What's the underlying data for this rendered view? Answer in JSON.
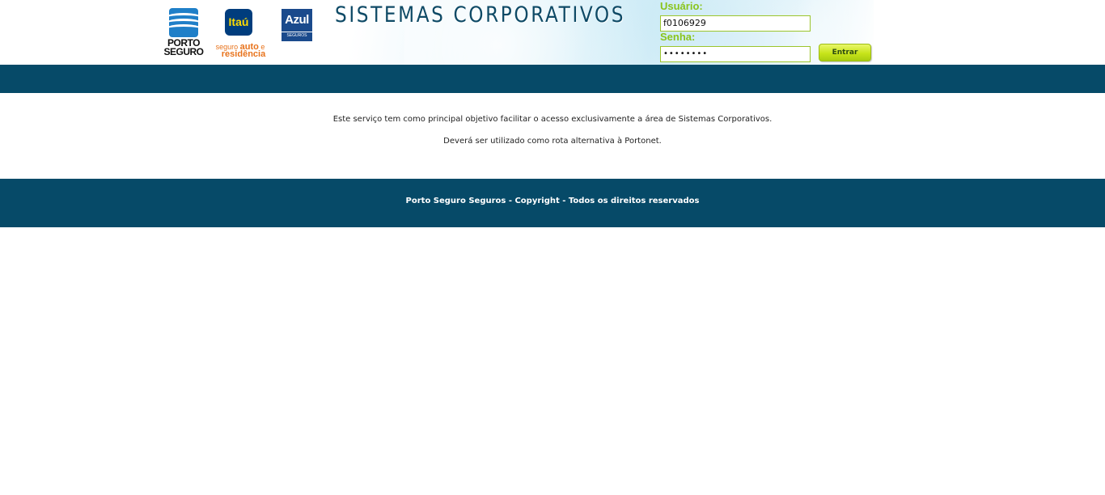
{
  "header": {
    "title": "SISTEMAS CORPORATIVOS",
    "logos": {
      "porto": {
        "line1": "PORTO",
        "line2": "SEGURO"
      },
      "itau": {
        "mark": "Itaú",
        "sub_seguro": "seguro",
        "sub_auto": "auto",
        "sub_e": "e",
        "sub_residencia": "residência"
      },
      "azul": {
        "word": "Azul",
        "sub": "SEGUROS"
      }
    }
  },
  "login": {
    "user_label": "Usuário:",
    "user_value": "f0106929",
    "password_label": "Senha:",
    "password_value": "••••••••",
    "submit_label": "Entrar"
  },
  "content": {
    "line1": "Este serviço tem como principal objetivo facilitar o acesso exclusivamente a área de Sistemas Corporativos.",
    "line2": "Deverá ser utilizado como rota alternativa à Portonet."
  },
  "footer": {
    "text": "Porto Seguro Seguros - Copyright - Todos os direitos reservados"
  },
  "colors": {
    "bar": "#064a68",
    "accent_green": "#8ac41b",
    "title_blue": "#0e4a66"
  }
}
